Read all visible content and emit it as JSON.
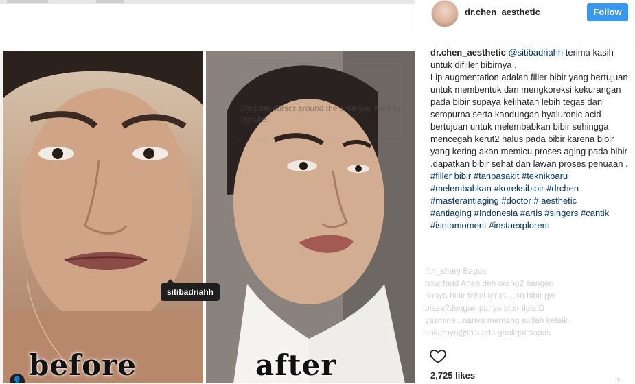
{
  "post": {
    "username": "dr.chen_aesthetic",
    "follow_label": "Follow",
    "caption_author": "dr.chen_aesthetic",
    "caption_mention": "@sitibadriahh",
    "caption_line1": " terima kasih untuk difiller bibirnya .",
    "caption_body": "Lip augmentation adalah filler bibir yang bertujuan untuk membentuk dan mengkoreksi kekurangan pada bibir supaya kelihatan lebih tegas dan sempurna serta kandungan hyaluronic acid bertujuan untuk melembabkan bibir sehingga mencegah kerut2 halus pada bibir karena bibir yang kering akan memicu proses aging pada bibir .dapatkan bibir sehat dan lawan proses penuaan .",
    "hashtags": {
      "line1": "#filler bibir #tanpasakit #teknikbaru",
      "line2": "#melembabkan #koreksibibir #drchen",
      "line3": "#masterantiaging #doctor # aesthetic",
      "line4": "#antiaging #Indonesia #artis #singers #cantik",
      "line5": "#isntamoment #instaexplorers"
    },
    "likes": "2,725 likes"
  },
  "media": {
    "before_label": "before",
    "after_label": "after",
    "user_tag": "sitibadriahh",
    "overlay_hint": "Drag the cursor around the area you want to capture."
  },
  "comments_faded": {
    "line1": "fitri_shery Bagus",
    "line2": "nowrfarid Aneh deh orang2 bangen",
    "line3": "punya bibir tebel terus....an bibir gw",
    "line4": "biasa?dengan punya bibir tipis:D",
    "line5": "yasmine...nanya memang sudah ketaik",
    "line6": "sukaraya@ta's ada ghaligat sapas"
  },
  "icons": {
    "heart": "heart-icon",
    "tag": "user-tag-icon"
  },
  "colors": {
    "follow": "#3897f0",
    "link": "#003569"
  }
}
